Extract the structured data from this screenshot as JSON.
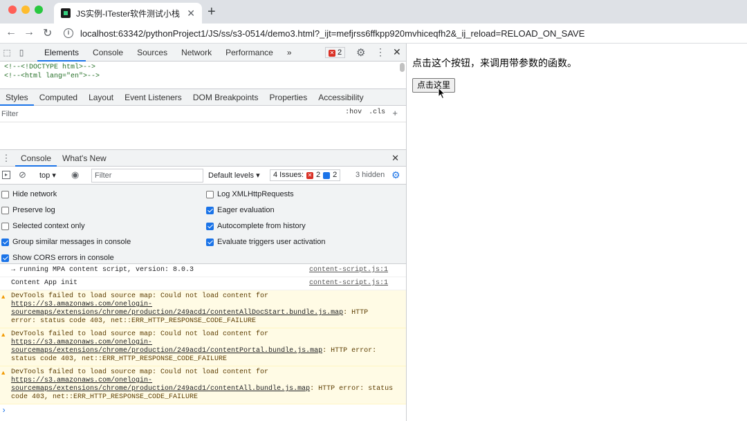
{
  "browser": {
    "tab_title": "JS实例-ITester软件测试小栈",
    "tab_close": "✕",
    "new_tab": "+",
    "url": "localhost:63342/pythonProject1/JS/ss/s3-0514/demo3.html?_ijt=mefjrss6ffkpp920mvhiceqfh2&_ij_reload=RELOAD_ON_SAVE"
  },
  "devtools": {
    "tabs": [
      "Elements",
      "Console",
      "Sources",
      "Network",
      "Performance"
    ],
    "more": "»",
    "error_count": "2",
    "elements_lines": [
      "<!--<!DOCTYPE html>-->",
      "<!--<html lang=\"en\">-->"
    ],
    "sub_tabs": [
      "Styles",
      "Computed",
      "Layout",
      "Event Listeners",
      "DOM Breakpoints",
      "Properties",
      "Accessibility"
    ],
    "styles_filter": "Filter",
    "hov": ":hov",
    "cls": ".cls",
    "plus": "+",
    "drawer_tabs": [
      "Console",
      "What's New"
    ],
    "context": "top",
    "console_filter": "Filter",
    "levels": "Default levels",
    "issues_label": "4 Issues:",
    "issues_errors": "2",
    "issues_info": "2",
    "hidden": "3 hidden",
    "settings": [
      {
        "label": "Hide network",
        "checked": false
      },
      {
        "label": "Preserve log",
        "checked": false
      },
      {
        "label": "Selected context only",
        "checked": false
      },
      {
        "label": "Group similar messages in console",
        "checked": true
      },
      {
        "label": "Show CORS errors in console",
        "checked": true
      },
      {
        "label": "Log XMLHttpRequests",
        "checked": false
      },
      {
        "label": "Eager evaluation",
        "checked": true
      },
      {
        "label": "Autocomplete from history",
        "checked": true
      },
      {
        "label": "Evaluate triggers user activation",
        "checked": true
      }
    ],
    "logs": [
      {
        "text": "→ running MPA content script, version: 8.0.3",
        "src": "content-script.js:1"
      },
      {
        "text": "Content App init",
        "src": "content-script.js:1"
      }
    ],
    "warnings": [
      {
        "pre": "DevTools failed to load source map: Could not load content for ",
        "url": "https://s3.amazonaws.com/onelogin-sourcemaps/extensions/chrome/production/249acd1/contentAllDocStart.bundle.js.map",
        "post": ": HTTP error: status code 403, net::ERR_HTTP_RESPONSE_CODE_FAILURE"
      },
      {
        "pre": "DevTools failed to load source map: Could not load content for ",
        "url": "https://s3.amazonaws.com/onelogin-sourcemaps/extensions/chrome/production/249acd1/contentPortal.bundle.js.map",
        "post": ": HTTP error: status code 403, net::ERR_HTTP_RESPONSE_CODE_FAILURE"
      },
      {
        "pre": "DevTools failed to load source map: Could not load content for ",
        "url": "https://s3.amazonaws.com/onelogin-sourcemaps/extensions/chrome/production/249acd1/contentAll.bundle.js.map",
        "post": ": HTTP error: status code 403, net::ERR_HTTP_RESPONSE_CODE_FAILURE"
      }
    ],
    "prompt": "›"
  },
  "page": {
    "text": "点击这个按钮，来调用带参数的函数。",
    "button_label": "点击这里"
  },
  "colors": {
    "accent": "#1a73e8",
    "warning_bg": "#fffbe5",
    "error": "#d93025"
  }
}
